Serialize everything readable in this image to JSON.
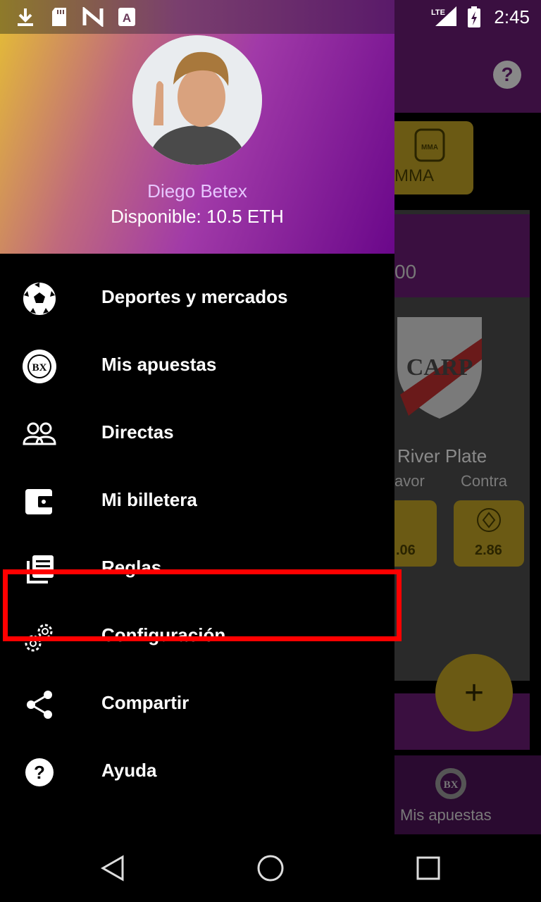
{
  "status_bar": {
    "time": "2:45",
    "network": "LTE",
    "icons": [
      "download-icon",
      "sd-card-icon",
      "android-n-icon",
      "font-a-icon",
      "signal-icon",
      "battery-charging-icon"
    ]
  },
  "drawer": {
    "user_name": "Diego Betex",
    "balance": "Disponible:  10.5 ETH",
    "items": [
      {
        "label": "Deportes y mercados",
        "icon": "soccer-ball-icon"
      },
      {
        "label": "Mis apuestas",
        "icon": "bx-chip-icon"
      },
      {
        "label": "Directas",
        "icon": "people-icon"
      },
      {
        "label": "Mi billetera",
        "icon": "wallet-icon"
      },
      {
        "label": "Reglas",
        "icon": "rules-icon"
      },
      {
        "label": "Configuración",
        "icon": "gears-icon"
      },
      {
        "label": "Compartir",
        "icon": "share-icon"
      },
      {
        "label": "Ayuda",
        "icon": "help-icon"
      }
    ],
    "highlighted_item": "Reglas"
  },
  "background": {
    "help_symbol": "?",
    "category_label": "MMA",
    "card_value_fragment": "00",
    "team_name": "River Plate",
    "shield_text": "CARP",
    "favor_label": "avor",
    "contra_label": "Contra",
    "odds": [
      ".06",
      "2.86"
    ],
    "fab_symbol": "+",
    "bottom_nav_label": "Mis apuestas",
    "bx_text": "BX"
  },
  "colors": {
    "accent_purple": "#6a078a",
    "gold": "#6b5a14",
    "highlight_red": "#ff0000"
  }
}
